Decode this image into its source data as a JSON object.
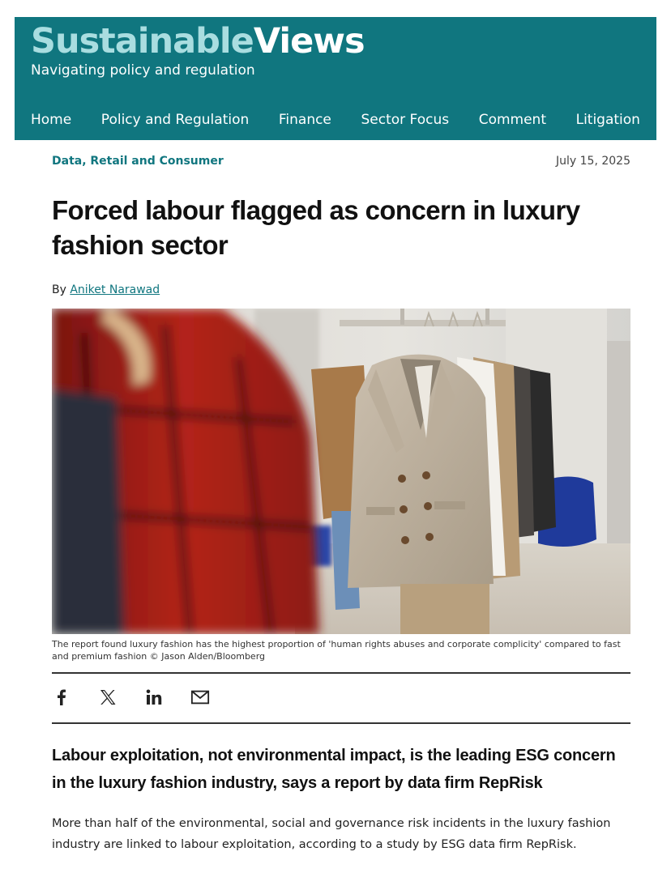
{
  "site": {
    "logo_part1": "Sustainable",
    "logo_part2": "Views",
    "tagline": "Navigating policy and regulation",
    "brand_color": "#10767f",
    "logo_accent_color": "#a9dde0"
  },
  "nav": {
    "items": [
      "Home",
      "Policy and Regulation",
      "Finance",
      "Sector Focus",
      "Comment",
      "Litigation"
    ]
  },
  "article": {
    "category": "Data, Retail and Consumer",
    "date": "July 15, 2025",
    "headline": "Forced labour flagged as concern in luxury fashion sector",
    "byline_prefix": "By",
    "author": "Aniket Narawad",
    "image_caption": "The report found luxury fashion has the highest proportion of 'human rights abuses and corporate complicity' compared to fast and premium fashion © Jason Alden/Bloomberg",
    "standfirst": "Labour exploitation, not environmental impact, is the leading ESG concern in the luxury fashion industry, says a report by data firm RepRisk",
    "body": "More than half of the environmental, social and governance risk incidents in the luxury fashion industry are linked to labour exploitation, according to a study by ESG data firm RepRisk."
  },
  "share": {
    "icons": [
      "facebook-icon",
      "x-icon",
      "linkedin-icon",
      "email-icon"
    ]
  }
}
